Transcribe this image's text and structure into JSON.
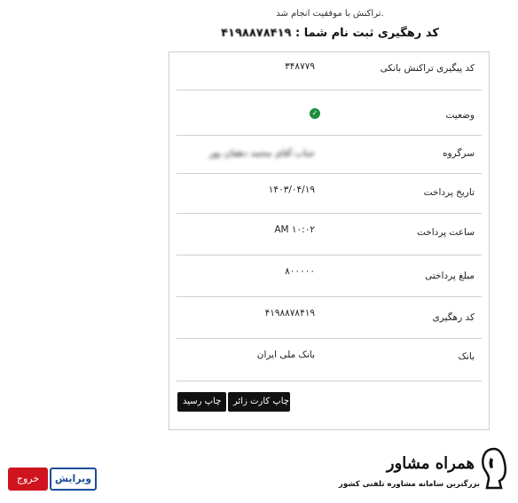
{
  "header": {
    "success_message": "تراکنش با موفقیت انجام شد.",
    "tracking_label": "کد رهگیری ثبت نام شما :",
    "tracking_code": "۴۱۹۸۸۷۸۴۱۹"
  },
  "receipt": {
    "rows": [
      {
        "label": "کد پیگیری تراکنش بانکی",
        "value": "۳۴۸۷۷۹"
      },
      {
        "label": "وضعیت",
        "value": "✓"
      },
      {
        "label": "سرگروه",
        "value": "جناب آقای محمد دهقان پور"
      },
      {
        "label": "تاریخ پرداخت",
        "value": "۱۴۰۳/۰۴/۱۹"
      },
      {
        "label": "ساعت پرداخت",
        "value": "AM ۱۰:۰۲"
      },
      {
        "label": "مبلغ پرداختی",
        "value": "۸۰۰۰۰۰"
      },
      {
        "label": "کد رهگیری",
        "value": "۴۱۹۸۸۷۸۴۱۹"
      },
      {
        "label": "بانک",
        "value": "بانک ملی ایران"
      }
    ],
    "status_color": "#1a8f3c",
    "print_visitor_card_label": "چاپ کارت زائر",
    "print_receipt_label": "چاپ رسید"
  },
  "footer": {
    "logout_label": "خروج",
    "edit_label": "ویرایش",
    "logo_title": "همراه مشاور",
    "logo_subtitle": "بزرگترین سامانه مشاوره تلفنی کشور",
    "logout_color": "#d0141f",
    "edit_color": "#1a4f96"
  }
}
